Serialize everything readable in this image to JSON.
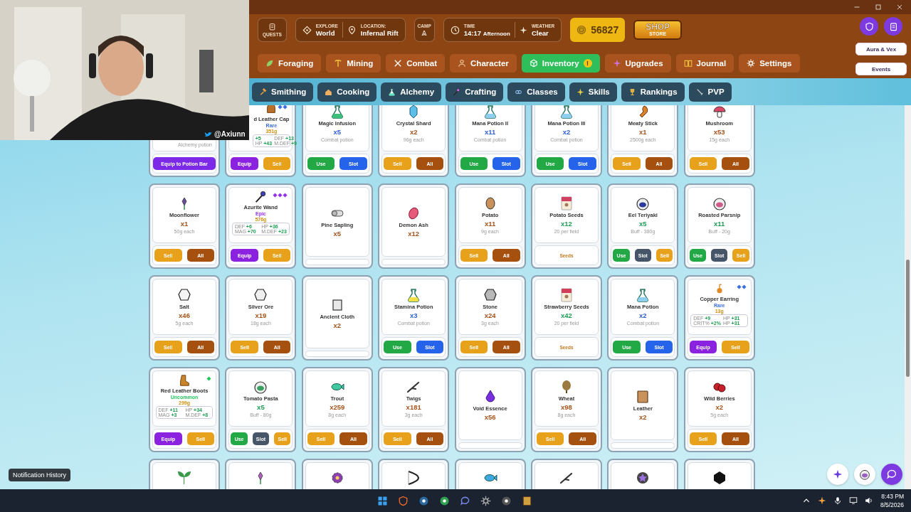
{
  "webcam": {
    "handle": "@Axiunn"
  },
  "header": {
    "quests": "QUESTS",
    "explore": {
      "label": "EXPLORE",
      "value": "World"
    },
    "location": {
      "label": "LOCATION:",
      "value": "Infernal Rift"
    },
    "camp": "CAMP",
    "time": {
      "label": "TIME",
      "value": "14:17",
      "period": "Afternoon"
    },
    "weather": {
      "label": "WEATHER",
      "value": "Clear"
    },
    "gold": "56827",
    "shop": {
      "title": "SHOP",
      "subtitle": "STORE"
    }
  },
  "main_tabs": [
    {
      "label": "Foraging",
      "selected": false
    },
    {
      "label": "Mining",
      "selected": false
    },
    {
      "label": "Combat",
      "selected": false
    },
    {
      "label": "Character",
      "selected": false
    },
    {
      "label": "Inventory",
      "selected": true,
      "badge": "!"
    },
    {
      "label": "Upgrades",
      "selected": false
    },
    {
      "label": "Journal",
      "selected": false
    },
    {
      "label": "Settings",
      "selected": false
    }
  ],
  "sub_tabs": [
    {
      "label": "Smithing"
    },
    {
      "label": "Cooking"
    },
    {
      "label": "Alchemy"
    },
    {
      "label": "Crafting"
    },
    {
      "label": "Classes"
    },
    {
      "label": "Skills"
    },
    {
      "label": "Rankings"
    },
    {
      "label": "PVP"
    }
  ],
  "side_buttons": [
    "Aura & Vex",
    "Events"
  ],
  "items": [
    {
      "kind": "potion",
      "covered": true,
      "note": "Alchemy potion",
      "buttons": [
        {
          "label": "Equip to Potion Bar",
          "kind": "potion-bar"
        }
      ]
    },
    {
      "kind": "equipment",
      "covered": true,
      "name": "d Leather Cap",
      "rarity": {
        "label": "Rare",
        "kind": "rare",
        "color": "#3b6fe0"
      },
      "price": "351g",
      "stats": [
        {
          "value": "+5"
        },
        {
          "label": "DEF",
          "value": "+13"
        },
        {
          "label": "HP",
          "value": "+43"
        },
        {
          "label": "M.DEF",
          "value": "+9"
        }
      ],
      "buttons": [
        {
          "label": "Equip",
          "kind": "equip"
        },
        {
          "label": "Sell",
          "kind": "sell"
        }
      ]
    },
    {
      "kind": "potion",
      "name": "Magic Infusion",
      "count": "x5",
      "note": "Combat potion",
      "buttons": [
        {
          "label": "Use",
          "kind": "use"
        },
        {
          "label": "Slot",
          "kind": "slot"
        }
      ]
    },
    {
      "kind": "material",
      "name": "Crystal Shard",
      "count": "x2",
      "note": "96g each",
      "buttons": [
        {
          "label": "Sell",
          "kind": "sell"
        },
        {
          "label": "All",
          "kind": "all"
        }
      ]
    },
    {
      "kind": "potion",
      "name": "Mana Potion II",
      "count": "x11",
      "note": "Combat potion",
      "buttons": [
        {
          "label": "Use",
          "kind": "use"
        },
        {
          "label": "Slot",
          "kind": "slot"
        }
      ]
    },
    {
      "kind": "potion",
      "name": "Mana Potion III",
      "count": "x2",
      "note": "Combat potion",
      "buttons": [
        {
          "label": "Use",
          "kind": "use"
        },
        {
          "label": "Slot",
          "kind": "slot"
        }
      ]
    },
    {
      "kind": "material",
      "name": "Meaty Stick",
      "count": "x1",
      "note": "2500g each",
      "buttons": [
        {
          "label": "Sell",
          "kind": "sell"
        },
        {
          "label": "All",
          "kind": "all"
        }
      ]
    },
    {
      "kind": "material",
      "name": "Mushroom",
      "count": "x53",
      "note": "15g each",
      "buttons": [
        {
          "label": "Sell",
          "kind": "sell"
        },
        {
          "label": "All",
          "kind": "all"
        }
      ]
    },
    {
      "kind": "material",
      "name": "Moonflower",
      "count": "x1",
      "note": "50g each",
      "buttons": [
        {
          "label": "Sell",
          "kind": "sell"
        },
        {
          "label": "All",
          "kind": "all"
        }
      ]
    },
    {
      "kind": "equipment",
      "name": "Azurite Wand",
      "rarity": {
        "label": "Epic",
        "kind": "epic",
        "color": "#9333ea"
      },
      "price": "576g",
      "stats": [
        {
          "label": "DEF",
          "value": "+6"
        },
        {
          "label": "HP",
          "value": "+36"
        },
        {
          "label": "MAG",
          "value": "+70"
        },
        {
          "label": "M.DEF",
          "value": "+23"
        }
      ],
      "buttons": [
        {
          "label": "Equip",
          "kind": "equip"
        },
        {
          "label": "Sell",
          "kind": "sell"
        }
      ]
    },
    {
      "kind": "material",
      "name": "Pine Sapling",
      "count": "x5"
    },
    {
      "kind": "material",
      "name": "Demon Ash",
      "count": "x12"
    },
    {
      "kind": "material",
      "name": "Potato",
      "count": "x11",
      "note": "9g each",
      "buttons": [
        {
          "label": "Sell",
          "kind": "sell"
        },
        {
          "label": "All",
          "kind": "all"
        }
      ]
    },
    {
      "kind": "seed",
      "name": "Potato Seeds",
      "count": "x12",
      "note": "20 per field",
      "footer": "Seeds"
    },
    {
      "kind": "food",
      "name": "Eel Teriyaki",
      "count": "x5",
      "note": "Buff - 380g",
      "buttons": [
        {
          "label": "Use",
          "kind": "use"
        },
        {
          "label": "Slot",
          "kind": "slot"
        },
        {
          "label": "Sell",
          "kind": "sell"
        }
      ]
    },
    {
      "kind": "food",
      "name": "Roasted Parsnip",
      "count": "x11",
      "note": "Buff - 20g",
      "buttons": [
        {
          "label": "Use",
          "kind": "use"
        },
        {
          "label": "Slot",
          "kind": "slot"
        },
        {
          "label": "Sell",
          "kind": "sell"
        }
      ]
    },
    {
      "kind": "material",
      "name": "Salt",
      "count": "x46",
      "note": "5g each",
      "buttons": [
        {
          "label": "Sell",
          "kind": "sell"
        },
        {
          "label": "All",
          "kind": "all"
        }
      ]
    },
    {
      "kind": "material",
      "name": "Silver Ore",
      "count": "x19",
      "note": "18g each",
      "buttons": [
        {
          "label": "Sell",
          "kind": "sell"
        },
        {
          "label": "All",
          "kind": "all"
        }
      ]
    },
    {
      "kind": "material",
      "name": "Ancient Cloth",
      "count": "x2"
    },
    {
      "kind": "potion",
      "name": "Stamina Potion",
      "count": "x3",
      "note": "Combat potion",
      "buttons": [
        {
          "label": "Use",
          "kind": "use"
        },
        {
          "label": "Slot",
          "kind": "slot"
        }
      ]
    },
    {
      "kind": "material",
      "name": "Stone",
      "count": "x24",
      "note": "3g each",
      "buttons": [
        {
          "label": "Sell",
          "kind": "sell"
        },
        {
          "label": "All",
          "kind": "all"
        }
      ]
    },
    {
      "kind": "seed",
      "name": "Strawberry Seeds",
      "count": "x42",
      "note": "20 per field",
      "footer": "Seeds"
    },
    {
      "kind": "potion",
      "name": "Mana Potion",
      "count": "x2",
      "note": "Combat potion",
      "buttons": [
        {
          "label": "Use",
          "kind": "use"
        },
        {
          "label": "Slot",
          "kind": "slot"
        }
      ]
    },
    {
      "kind": "equipment",
      "name": "Copper Earring",
      "rarity": {
        "label": "Rare",
        "kind": "rare",
        "color": "#3b6fe0"
      },
      "price": "13g",
      "stats": [
        {
          "label": "DEF",
          "value": "+9"
        },
        {
          "label": "HP",
          "value": "+31"
        },
        {
          "label": "CRIT%",
          "value": "+2%"
        },
        {
          "label": "HP",
          "value": "+31"
        }
      ],
      "buttons": [
        {
          "label": "Equip",
          "kind": "equip"
        },
        {
          "label": "Sell",
          "kind": "sell"
        }
      ]
    },
    {
      "kind": "equipment",
      "name": "Red Leather Boots",
      "rarity": {
        "label": "Uncommon",
        "kind": "uncommon",
        "color": "#22c55e"
      },
      "price": "299g",
      "stats": [
        {
          "label": "DEF",
          "value": "+11"
        },
        {
          "label": "HP",
          "value": "+34"
        },
        {
          "label": "MAG",
          "value": "+3"
        },
        {
          "label": "M.DEF",
          "value": "+8"
        }
      ],
      "buttons": [
        {
          "label": "Equip",
          "kind": "equip"
        },
        {
          "label": "Sell",
          "kind": "sell"
        }
      ]
    },
    {
      "kind": "food",
      "name": "Tomato Pasta",
      "count": "x5",
      "note": "Buff - 80g",
      "buttons": [
        {
          "label": "Use",
          "kind": "use"
        },
        {
          "label": "Slot",
          "kind": "slot"
        },
        {
          "label": "Sell",
          "kind": "sell"
        }
      ]
    },
    {
      "kind": "material",
      "name": "Trout",
      "count": "x259",
      "note": "8g each",
      "buttons": [
        {
          "label": "Sell",
          "kind": "sell"
        },
        {
          "label": "All",
          "kind": "all"
        }
      ]
    },
    {
      "kind": "material",
      "name": "Twigs",
      "count": "x181",
      "note": "3g each",
      "buttons": [
        {
          "label": "Sell",
          "kind": "sell"
        },
        {
          "label": "All",
          "kind": "all"
        }
      ]
    },
    {
      "kind": "material",
      "name": "Void Essence",
      "count": "x56"
    },
    {
      "kind": "material",
      "name": "Wheat",
      "count": "x98",
      "note": "8g each",
      "buttons": [
        {
          "label": "Sell",
          "kind": "sell"
        },
        {
          "label": "All",
          "kind": "all"
        }
      ]
    },
    {
      "kind": "material",
      "name": "Leather",
      "count": "x2"
    },
    {
      "kind": "material",
      "name": "Wild Berries",
      "count": "x2",
      "note": "5g each",
      "buttons": [
        {
          "label": "Sell",
          "kind": "sell"
        },
        {
          "label": "All",
          "kind": "all"
        }
      ]
    },
    {
      "kind": "partial"
    },
    {
      "kind": "partial"
    },
    {
      "kind": "partial"
    },
    {
      "kind": "partial"
    },
    {
      "kind": "partial"
    },
    {
      "kind": "partial"
    },
    {
      "kind": "partial"
    },
    {
      "kind": "partial"
    }
  ],
  "notification": "Notification History",
  "taskbar": {
    "time": "8:43 PM",
    "date": "8/5/2026"
  }
}
